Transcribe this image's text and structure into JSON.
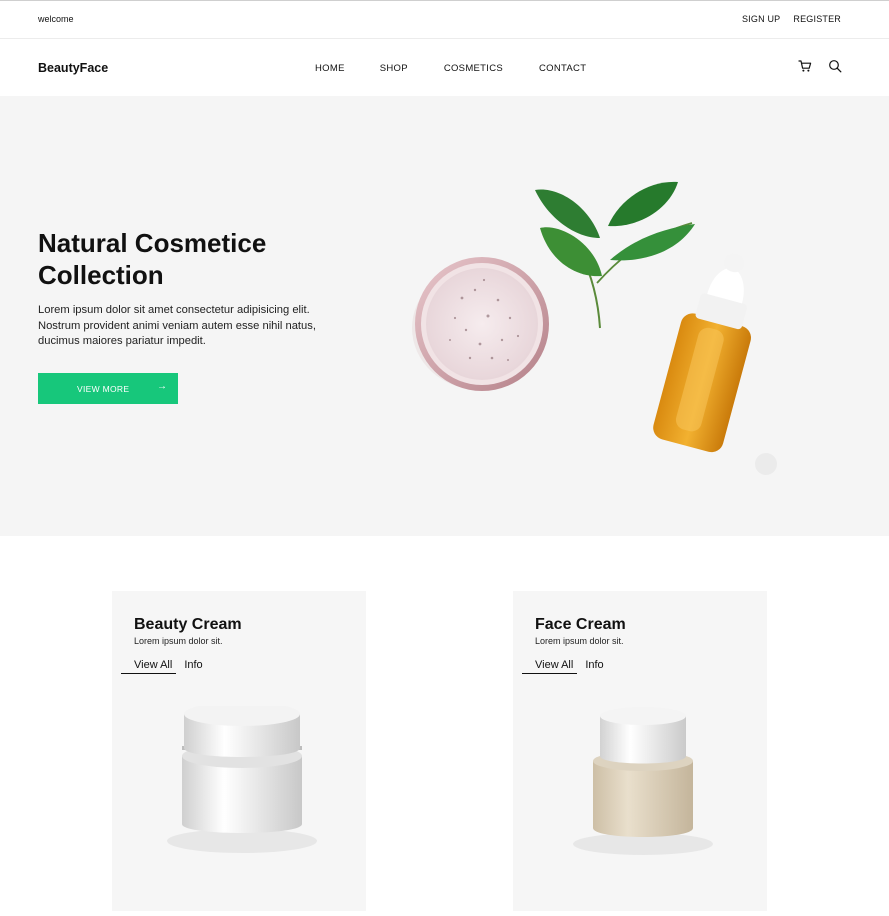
{
  "topbar": {
    "welcome": "welcome",
    "signup": "SIGN UP",
    "register": "REGISTER"
  },
  "nav": {
    "logo": "BeautyFace",
    "items": [
      "HOME",
      "SHOP",
      "COSMETICS",
      "CONTACT"
    ],
    "icons": [
      "cart-icon",
      "search-icon"
    ]
  },
  "hero": {
    "title": "Natural Cosmetice Collection",
    "text": "Lorem ipsum dolor sit amet consectetur adipisicing elit. Nostrum provident animi veniam autem esse nihil natus, ducimus maiores pariatur impedit.",
    "button": "VIEW MORE",
    "button_icon": "arrow-right-icon",
    "colors": {
      "background": "#f5f5f5",
      "accent": "#17c77b"
    }
  },
  "cards": [
    {
      "title": "Beauty Cream",
      "subtitle": "Lorem ipsum dolor sit.",
      "link_view": "View All",
      "link_info": "Info"
    },
    {
      "title": "Face Cream",
      "subtitle": "Lorem ipsum dolor sit.",
      "link_view": "View All",
      "link_info": "Info"
    }
  ]
}
